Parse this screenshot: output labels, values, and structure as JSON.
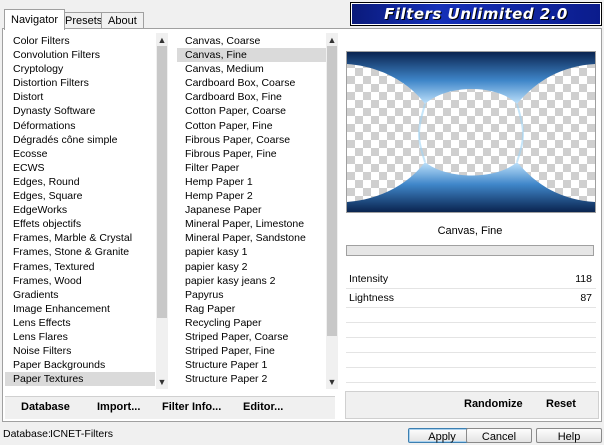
{
  "app": {
    "title": "Filters Unlimited 2.0"
  },
  "tabs": [
    {
      "label": "Navigator",
      "active": true
    },
    {
      "label": "Presets",
      "active": false
    },
    {
      "label": "About",
      "active": false
    }
  ],
  "categories": {
    "items": [
      "Color Filters",
      "Convolution Filters",
      "Cryptology",
      "Distortion Filters",
      "Distort",
      "Dynasty Software",
      "Déformations",
      "Dégradés cône simple",
      "Ecosse",
      "ECWS",
      "Edges, Round",
      "Edges, Square",
      "EdgeWorks",
      "Effets objectifs",
      "Frames, Marble & Crystal",
      "Frames, Stone & Granite",
      "Frames, Textured",
      "Frames, Wood",
      "Gradients",
      "Image Enhancement",
      "Lens Effects",
      "Lens Flares",
      "Noise Filters",
      "Paper Backgrounds",
      "Paper Textures"
    ],
    "selected_index": 24
  },
  "filters": {
    "items": [
      "Canvas, Coarse",
      "Canvas, Fine",
      "Canvas, Medium",
      "Cardboard Box, Coarse",
      "Cardboard Box, Fine",
      "Cotton Paper, Coarse",
      "Cotton Paper, Fine",
      "Fibrous Paper, Coarse",
      "Fibrous Paper, Fine",
      "Filter Paper",
      "Hemp Paper 1",
      "Hemp Paper 2",
      "Japanese Paper",
      "Mineral Paper, Limestone",
      "Mineral Paper, Sandstone",
      "papier kasy 1",
      "papier kasy 2",
      "papier kasy jeans 2",
      "Papyrus",
      "Rag Paper",
      "Recycling Paper",
      "Striped Paper, Coarse",
      "Striped Paper, Fine",
      "Structure Paper 1",
      "Structure Paper 2"
    ],
    "selected_index": 1
  },
  "preview": {
    "filter_name": "Canvas, Fine",
    "colors": {
      "band_dark": "#0a2450",
      "band_mid": "#3f86c9",
      "band_light": "#bfe2fb"
    }
  },
  "params": [
    {
      "label": "Intensity",
      "value": "118"
    },
    {
      "label": "Lightness",
      "value": "87"
    }
  ],
  "buttons": {
    "database": "Database",
    "import": "Import...",
    "filter_info": "Filter Info...",
    "editor": "Editor...",
    "randomize": "Randomize",
    "reset": "Reset",
    "apply": "Apply",
    "cancel": "Cancel",
    "help": "Help"
  },
  "status": {
    "database_label": "Database:",
    "database_value": "ICNET-Filters"
  },
  "colors": {
    "banner": "#1530b8",
    "selection": "#dadada"
  }
}
